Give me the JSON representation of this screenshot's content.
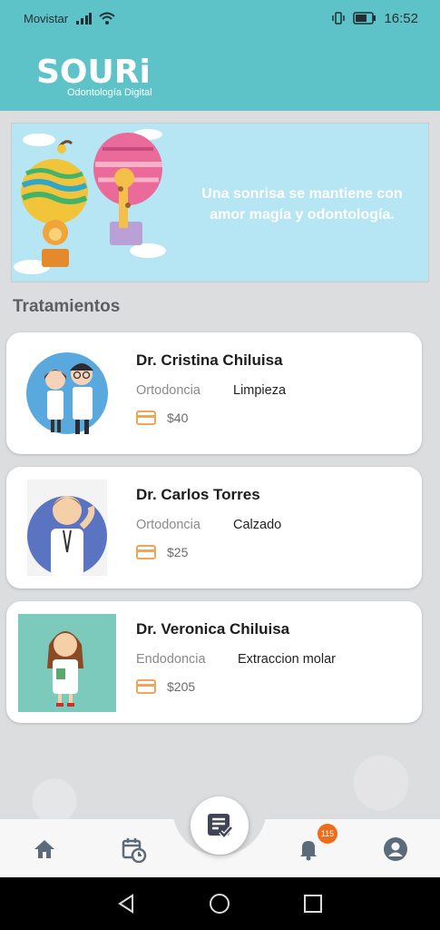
{
  "status_bar": {
    "carrier": "Movistar",
    "time": "16:52"
  },
  "app": {
    "logo_text": "SOURi",
    "logo_subtitle": "Odontología Digital"
  },
  "banner": {
    "slogan": "Una sonrisa se mantiene con amor magía y odontología."
  },
  "section_title": "Tratamientos",
  "doctors": [
    {
      "name": "Dr. Cristina Chiluisa",
      "specialty": "Ortodoncia",
      "treatment": "Limpieza",
      "price": "$40"
    },
    {
      "name": "Dr. Carlos Torres",
      "specialty": "Ortodoncia",
      "treatment": "Calzado",
      "price": "$25"
    },
    {
      "name": "Dr. Veronica Chiluisa",
      "specialty": "Endodoncia",
      "treatment": "Extraccion molar",
      "price": "$205"
    }
  ],
  "bottom_nav": {
    "items": [
      {
        "icon": "home-icon"
      },
      {
        "icon": "calendar-clock-icon"
      },
      {
        "icon": "notes-check-icon"
      },
      {
        "icon": "bell-icon"
      },
      {
        "icon": "account-icon"
      }
    ],
    "notification_count": "115"
  },
  "colors": {
    "primary": "#5ec3c8",
    "accent": "#ef6c1a",
    "price_icon": "#f0a45c"
  }
}
